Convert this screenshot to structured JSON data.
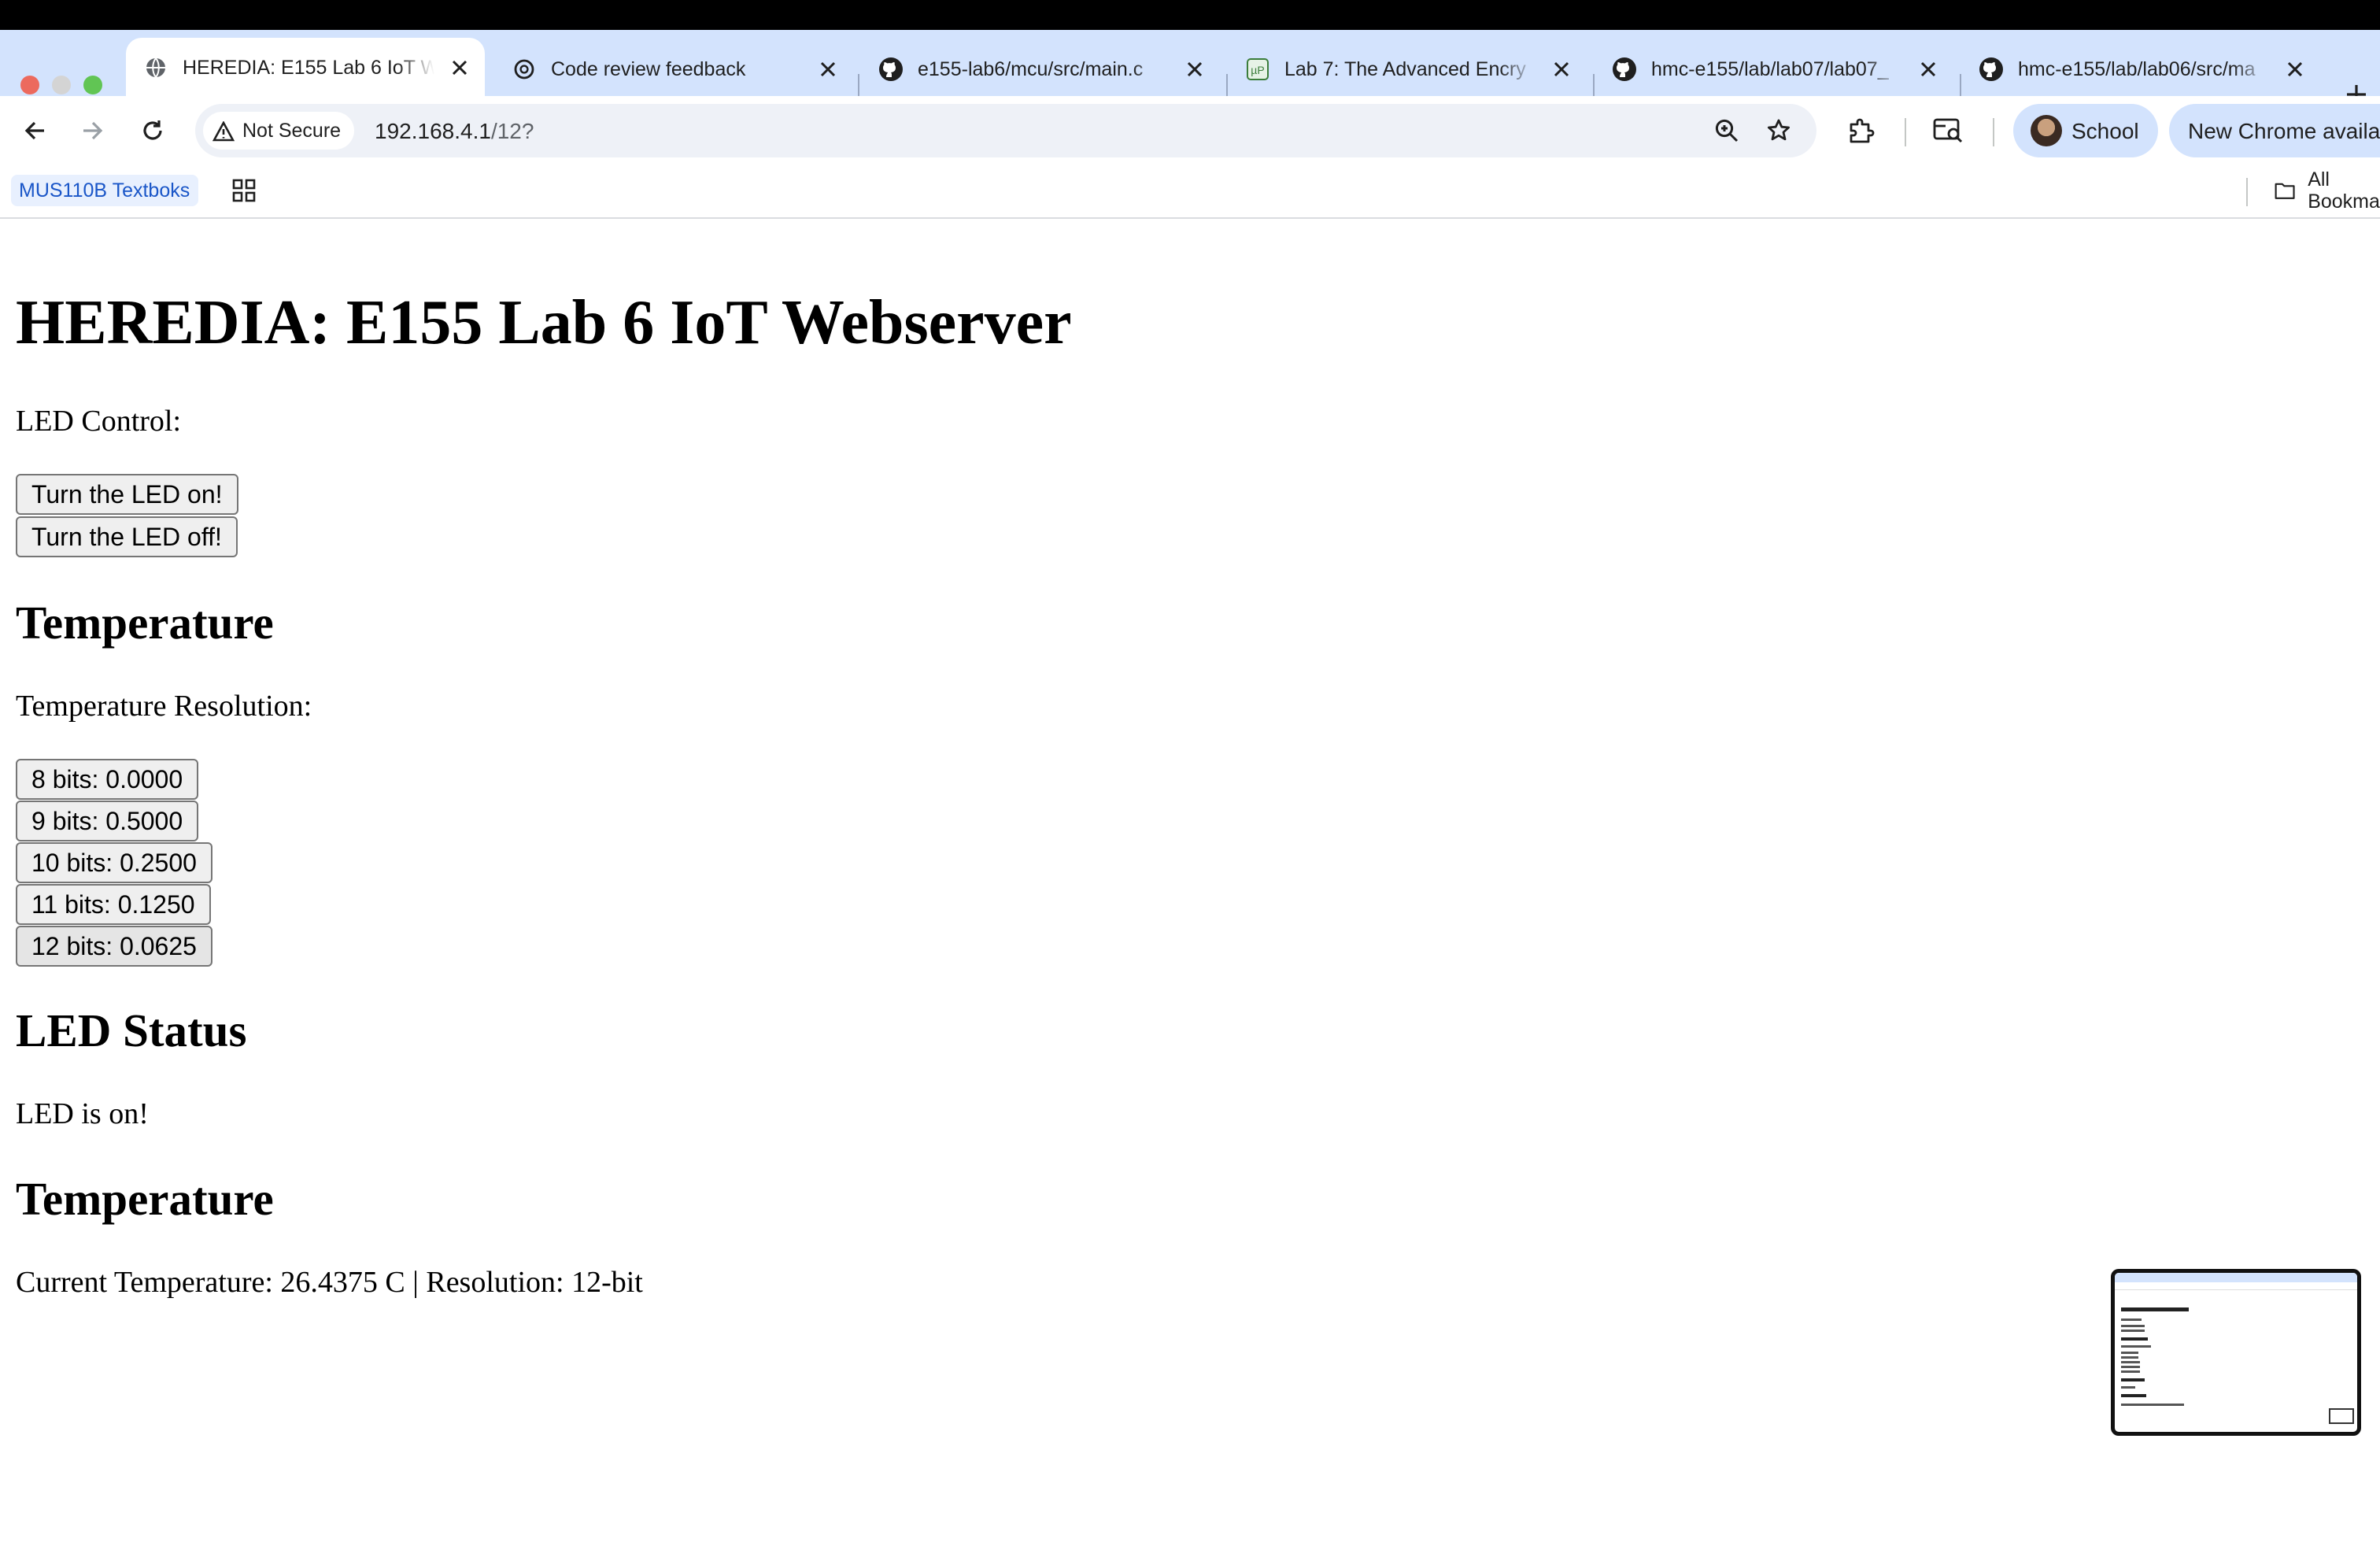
{
  "browser": {
    "tabs": [
      {
        "title": "HEREDIA: E155 Lab 6 IoT W",
        "icon": "globe-icon",
        "active": true
      },
      {
        "title": "Code review feedback",
        "icon": "openai-icon",
        "active": false
      },
      {
        "title": "e155-lab6/mcu/src/main.c",
        "icon": "github-icon",
        "active": false
      },
      {
        "title": "Lab 7: The Advanced Encry",
        "icon": "microp-icon",
        "active": false
      },
      {
        "title": "hmc-e155/lab/lab07/lab07_",
        "icon": "github-icon",
        "active": false
      },
      {
        "title": "hmc-e155/lab/lab06/src/ma",
        "icon": "github-icon",
        "active": false
      }
    ],
    "security_label": "Not Secure",
    "url_host": "192.168.4.1",
    "url_path": "/12?",
    "profile_label": "School",
    "update_label": "New Chrome available",
    "bookmarks": [
      "MUS110B Textboks"
    ],
    "all_bookmarks_label": "All Bookmarks",
    "colors": {
      "tabstrip": "#d3e3fd",
      "omnibox": "#eef1f7",
      "bookmark_text": "#1a56c8"
    }
  },
  "page": {
    "title": "HEREDIA: E155 Lab 6 IoT Webserver",
    "led_control_label": "LED Control:",
    "led_on_button": "Turn the LED on!",
    "led_off_button": "Turn the LED off!",
    "temperature_heading": "Temperature",
    "resolution_label": "Temperature Resolution:",
    "resolution_buttons": [
      "8 bits: 0.0000",
      "9 bits: 0.5000",
      "10 bits: 0.2500",
      "11 bits: 0.1250",
      "12 bits: 0.0625"
    ],
    "led_status_heading": "LED Status",
    "led_status_text": "LED is on!",
    "temperature_heading_2": "Temperature",
    "current_temperature_text": "Current Temperature: 26.4375 C | Resolution: 12-bit"
  }
}
